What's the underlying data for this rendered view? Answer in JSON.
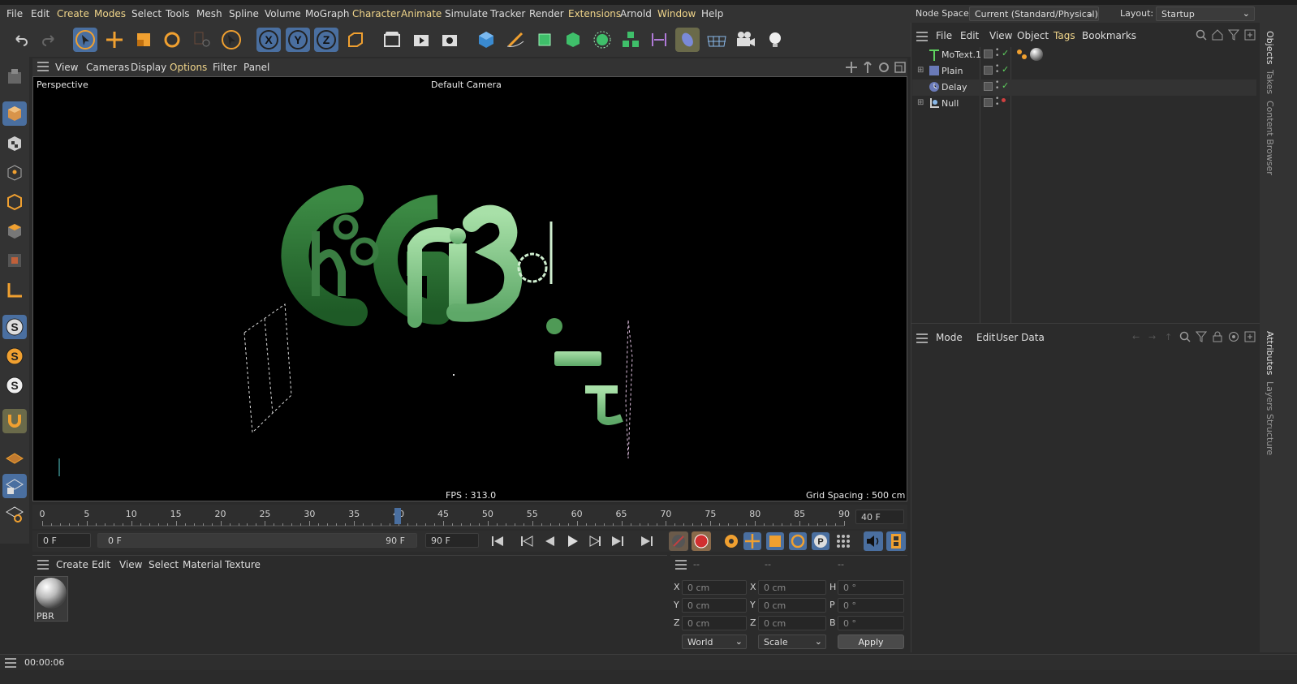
{
  "menubar": {
    "items": [
      "File",
      "Edit",
      "Create",
      "Modes",
      "Select",
      "Tools",
      "Mesh",
      "Spline",
      "Volume",
      "MoGraph",
      "Character",
      "Animate",
      "Simulate",
      "Tracker",
      "Render",
      "Extensions",
      "Arnold",
      "Window",
      "Help"
    ],
    "node_space_label": "Node Space:",
    "node_space_value": "Current (Standard/Physical)",
    "layout_label": "Layout:",
    "layout_value": "Startup"
  },
  "viewport_menu": {
    "items": [
      "View",
      "Cameras",
      "Display",
      "Options",
      "Filter",
      "Panel"
    ]
  },
  "viewport": {
    "view_name": "Perspective",
    "camera": "Default Camera",
    "fps": "FPS : 313.0",
    "grid_spacing": "Grid Spacing : 500 cm"
  },
  "timeline": {
    "ticks": [
      "0",
      "5",
      "10",
      "15",
      "20",
      "25",
      "30",
      "35",
      "40",
      "45",
      "50",
      "55",
      "60",
      "65",
      "70",
      "75",
      "80",
      "85",
      "90"
    ],
    "current_frame": "40 F",
    "playhead_frame": 40
  },
  "transport": {
    "start_field": "0 F",
    "range_start": "0 F",
    "range_end": "90 F",
    "end_field": "90 F"
  },
  "material_manager": {
    "menu": [
      "Create",
      "Edit",
      "View",
      "Select",
      "Material",
      "Texture"
    ],
    "materials": [
      {
        "name": "PBR"
      }
    ]
  },
  "coordinates": {
    "headers": [
      "--",
      "--",
      "--"
    ],
    "rows": [
      {
        "a_label": "X",
        "a_val": "0 cm",
        "b_label": "X",
        "b_val": "0 cm",
        "c_label": "H",
        "c_val": "0 °"
      },
      {
        "a_label": "Y",
        "a_val": "0 cm",
        "b_label": "Y",
        "b_val": "0 cm",
        "c_label": "P",
        "c_val": "0 °"
      },
      {
        "a_label": "Z",
        "a_val": "0 cm",
        "b_label": "Z",
        "b_val": "0 cm",
        "c_label": "B",
        "c_val": "0 °"
      }
    ],
    "world": "World",
    "scale": "Scale",
    "apply": "Apply"
  },
  "status": {
    "time": "00:00:06"
  },
  "object_manager": {
    "menu": [
      "File",
      "Edit",
      "View",
      "Object",
      "Tags",
      "Bookmarks"
    ],
    "objects": [
      {
        "name": "MoText.1"
      },
      {
        "name": "Plain"
      },
      {
        "name": "Delay"
      },
      {
        "name": "Null"
      }
    ]
  },
  "attributes": {
    "menu": [
      "Mode",
      "Edit",
      "User Data"
    ]
  },
  "side_tabs": [
    "Objects",
    "Takes",
    "Content Browser",
    "Attributes",
    "Layers",
    "Structure"
  ],
  "colors": {
    "accent": "#4a6fa0",
    "tag_orange": "#f0a030",
    "menu_highlight": "#f0d58a",
    "green_check": "#5fd35f"
  }
}
